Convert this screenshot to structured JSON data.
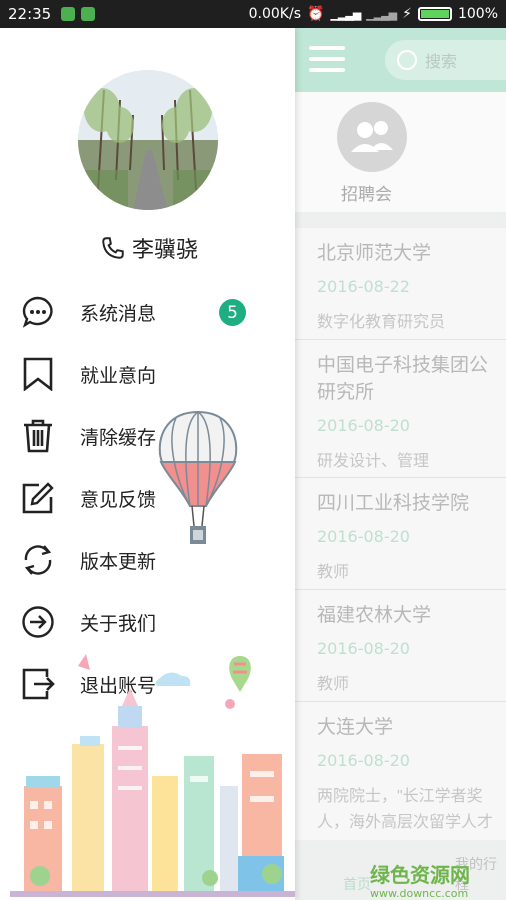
{
  "status_bar": {
    "time": "22:35",
    "network_speed": "0.00K/s",
    "battery_percent": "100%",
    "battery_level": 1.0
  },
  "drawer": {
    "username": "李骥骁",
    "menu": [
      {
        "label": "系统消息",
        "icon": "message-icon",
        "badge": "5"
      },
      {
        "label": "就业意向",
        "icon": "bookmark-icon"
      },
      {
        "label": "清除缓存",
        "icon": "trash-icon"
      },
      {
        "label": "意见反馈",
        "icon": "edit-icon"
      },
      {
        "label": "版本更新",
        "icon": "refresh-icon"
      },
      {
        "label": "关于我们",
        "icon": "arrow-circle-icon"
      },
      {
        "label": "退出账号",
        "icon": "logout-icon"
      }
    ]
  },
  "background_screen": {
    "search_placeholder": "搜索",
    "category_label": "招聘会",
    "jobs": [
      {
        "name": "北京师范大学",
        "date": "2016-08-22",
        "desc": "数字化教育研究员"
      },
      {
        "name": "中国电子科技集团公",
        "name2": "研究所",
        "date": "2016-08-20",
        "desc": "研发设计、管理"
      },
      {
        "name": "四川工业科技学院",
        "date": "2016-08-20",
        "desc": "教师"
      },
      {
        "name": "福建农林大学",
        "date": "2016-08-20",
        "desc": "教师"
      },
      {
        "name": "大连大学",
        "date": "2016-08-20",
        "desc": "两院院士，\"长江学者奖",
        "desc2": "人，海外高层次留学人才"
      }
    ],
    "nav_home": "首页",
    "nav_trip": "我的行程",
    "watermark": "绿色资源网",
    "watermark_url": "www.downcc.com"
  },
  "colors": {
    "accent": "#1fae82",
    "appbar": "#bfe6d6"
  }
}
